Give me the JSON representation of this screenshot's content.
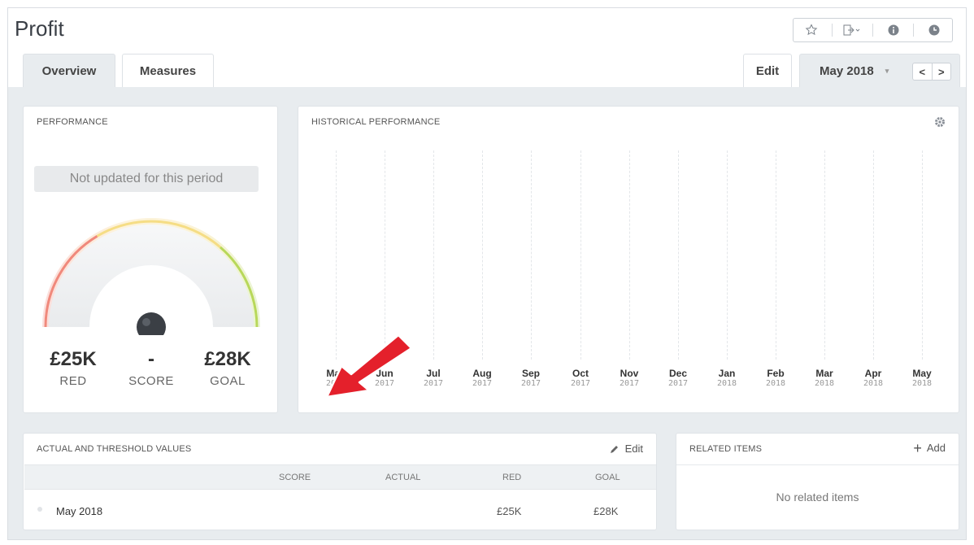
{
  "header": {
    "title": "Profit",
    "actions": [
      {
        "icon": "star-icon",
        "glyph": "☆"
      },
      {
        "icon": "share-icon",
        "glyph": "⇥"
      },
      {
        "icon": "info-icon",
        "glyph": "ℹ"
      },
      {
        "icon": "clock-icon",
        "glyph": "◷"
      }
    ]
  },
  "tabs": [
    {
      "label": "Overview",
      "active": true
    },
    {
      "label": "Measures",
      "active": false
    }
  ],
  "toolbar": {
    "edit_label": "Edit",
    "period_label": "May 2018",
    "prev_glyph": "<",
    "next_glyph": ">"
  },
  "performance": {
    "title": "PERFORMANCE",
    "status": "Not updated for this period",
    "red_value": "£25K",
    "red_label": "RED",
    "score_value": "-",
    "score_label": "SCORE",
    "goal_value": "£28K",
    "goal_label": "GOAL"
  },
  "historical": {
    "title": "HISTORICAL PERFORMANCE",
    "months": [
      {
        "m": "May",
        "y": "2017"
      },
      {
        "m": "Jun",
        "y": "2017"
      },
      {
        "m": "Jul",
        "y": "2017"
      },
      {
        "m": "Aug",
        "y": "2017"
      },
      {
        "m": "Sep",
        "y": "2017"
      },
      {
        "m": "Oct",
        "y": "2017"
      },
      {
        "m": "Nov",
        "y": "2017"
      },
      {
        "m": "Dec",
        "y": "2017"
      },
      {
        "m": "Jan",
        "y": "2018"
      },
      {
        "m": "Feb",
        "y": "2018"
      },
      {
        "m": "Mar",
        "y": "2018"
      },
      {
        "m": "Apr",
        "y": "2018"
      },
      {
        "m": "May",
        "y": "2018"
      }
    ]
  },
  "actual_threshold": {
    "title": "ACTUAL AND THRESHOLD VALUES",
    "edit_label": "Edit",
    "columns": [
      "SCORE",
      "ACTUAL",
      "RED",
      "GOAL"
    ],
    "rows": [
      {
        "period": "May 2018",
        "score": "",
        "actual": "",
        "red": "£25K",
        "goal": "£28K"
      }
    ]
  },
  "related": {
    "title": "RELATED ITEMS",
    "add_label": "Add",
    "empty_text": "No related items"
  },
  "colors": {
    "gauge_red": "#f0897c",
    "gauge_yellow": "#f5dd85",
    "gauge_green": "#b8d85a",
    "annotation_arrow": "#e4202b"
  }
}
